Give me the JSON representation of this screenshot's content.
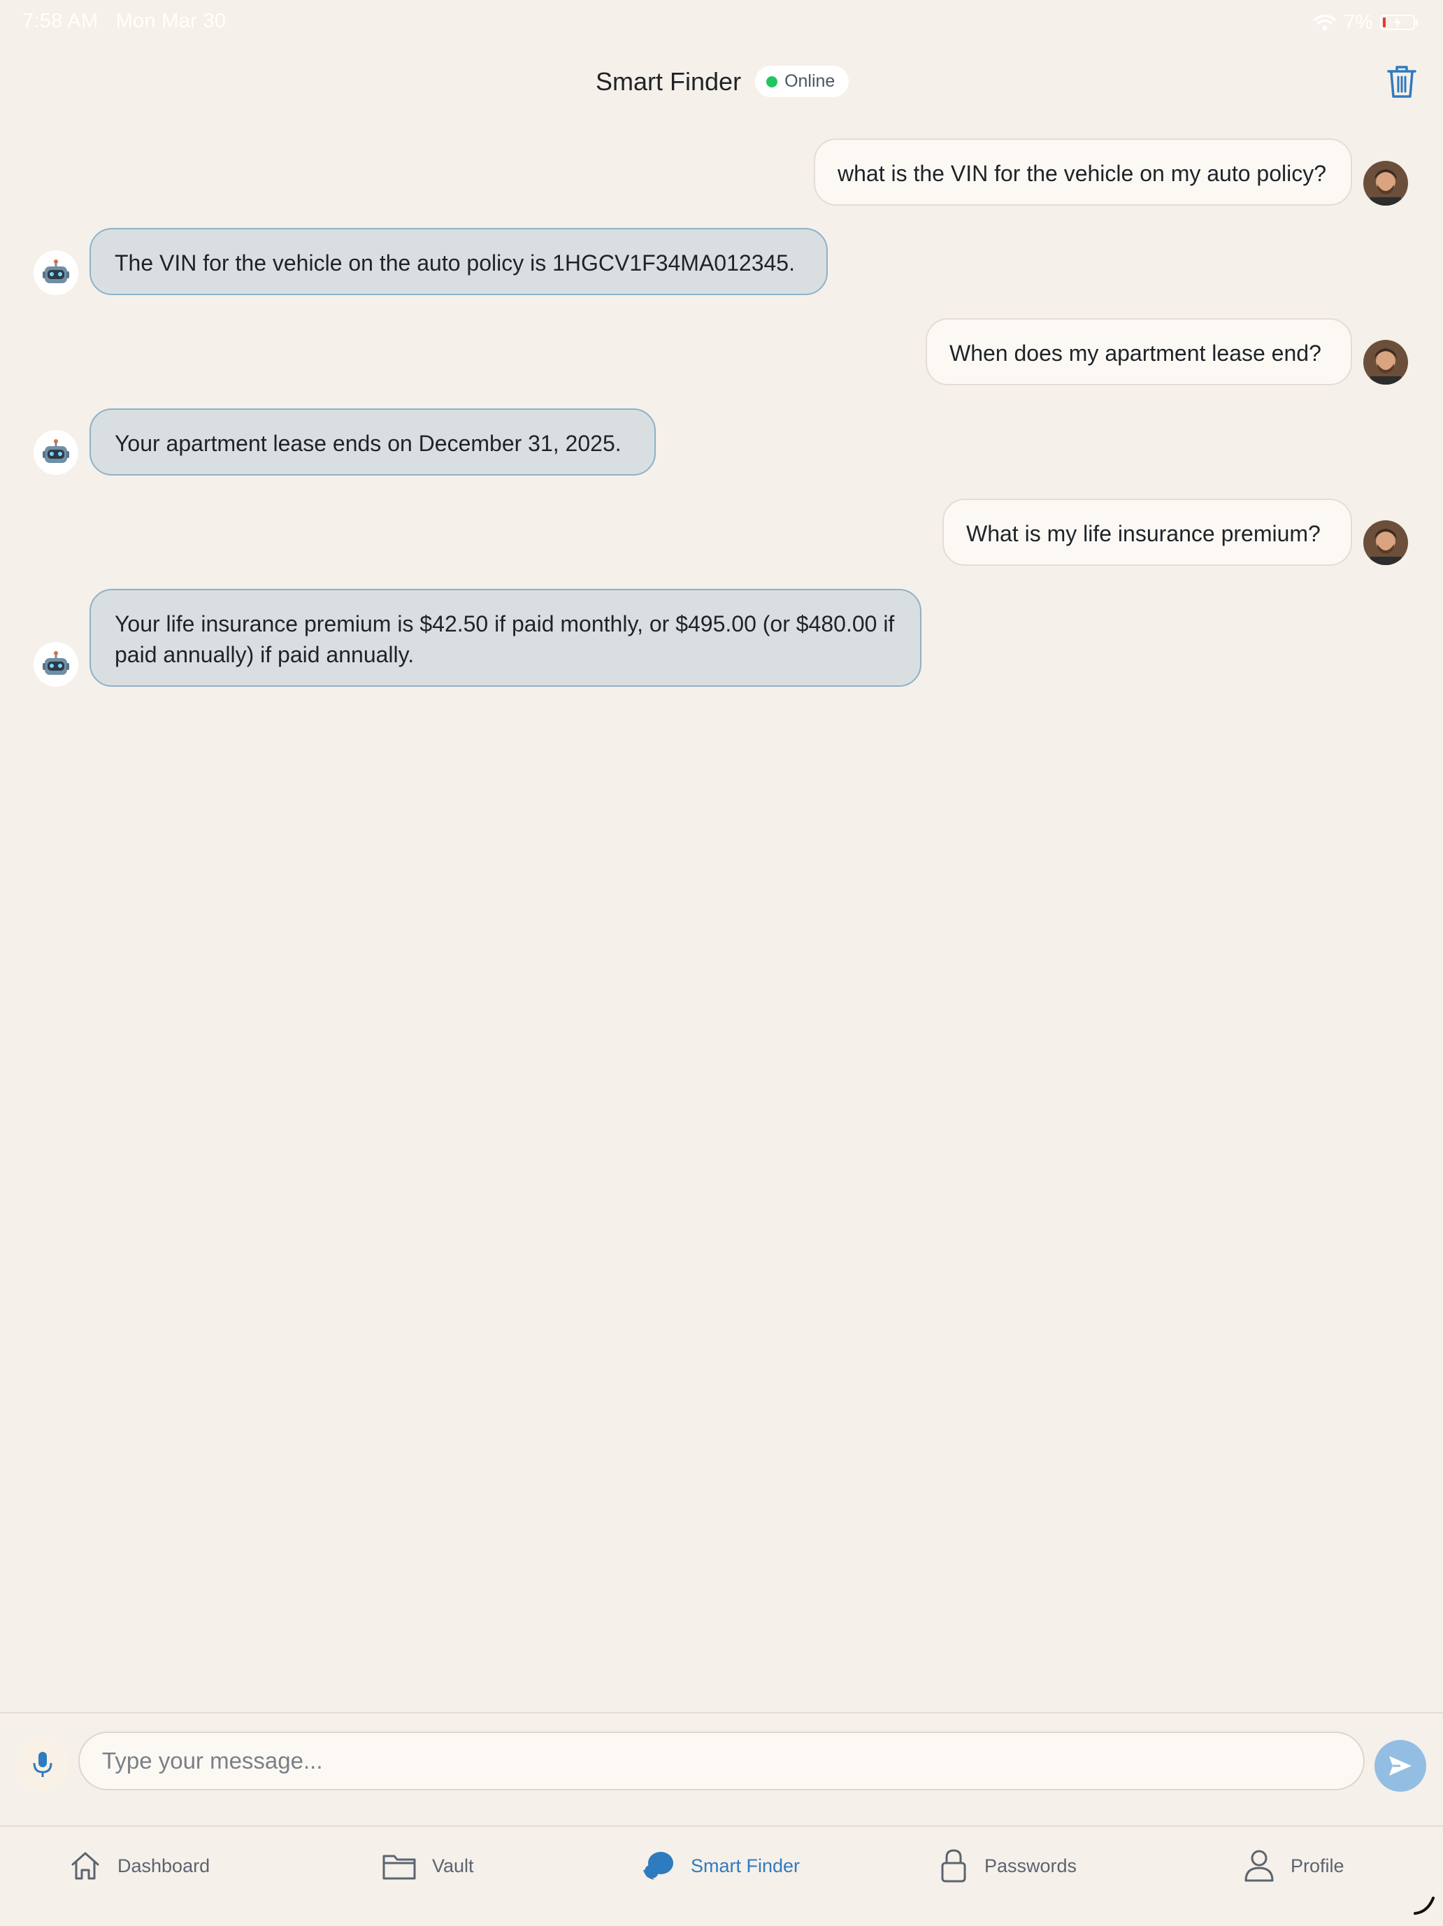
{
  "status_bar": {
    "time": "7:58 AM",
    "date": "Mon Mar 30",
    "battery": "7%"
  },
  "header": {
    "title": "Smart Finder",
    "status": "Online"
  },
  "messages": [
    {
      "role": "user",
      "text": "what is the VIN for the vehicle on my auto policy?"
    },
    {
      "role": "assistant",
      "text": "The VIN for the vehicle on the auto policy is 1HGCV1F34MA012345."
    },
    {
      "role": "user",
      "text": "When does my apartment lease end?"
    },
    {
      "role": "assistant",
      "text": "Your apartment lease ends on December 31, 2025."
    },
    {
      "role": "user",
      "text": "What is my life insurance premium?"
    },
    {
      "role": "assistant",
      "text": "Your life insurance premium is $42.50 if paid monthly, or $495.00 (or $480.00 if paid annually) if paid annually."
    }
  ],
  "composer": {
    "placeholder": "Type your message..."
  },
  "tabs": [
    {
      "label": "Dashboard",
      "icon": "home-icon",
      "active": false
    },
    {
      "label": "Vault",
      "icon": "folder-icon",
      "active": false
    },
    {
      "label": "Smart Finder",
      "icon": "chat-bubble-icon",
      "active": true
    },
    {
      "label": "Passwords",
      "icon": "lock-icon",
      "active": false
    },
    {
      "label": "Profile",
      "icon": "person-icon",
      "active": false
    }
  ],
  "colors": {
    "background": "#f5f0e9",
    "accent": "#2f7bbf",
    "online": "#22c55e",
    "bot_bubble": "#d9dfe0",
    "bot_border": "#8fb1c8"
  }
}
